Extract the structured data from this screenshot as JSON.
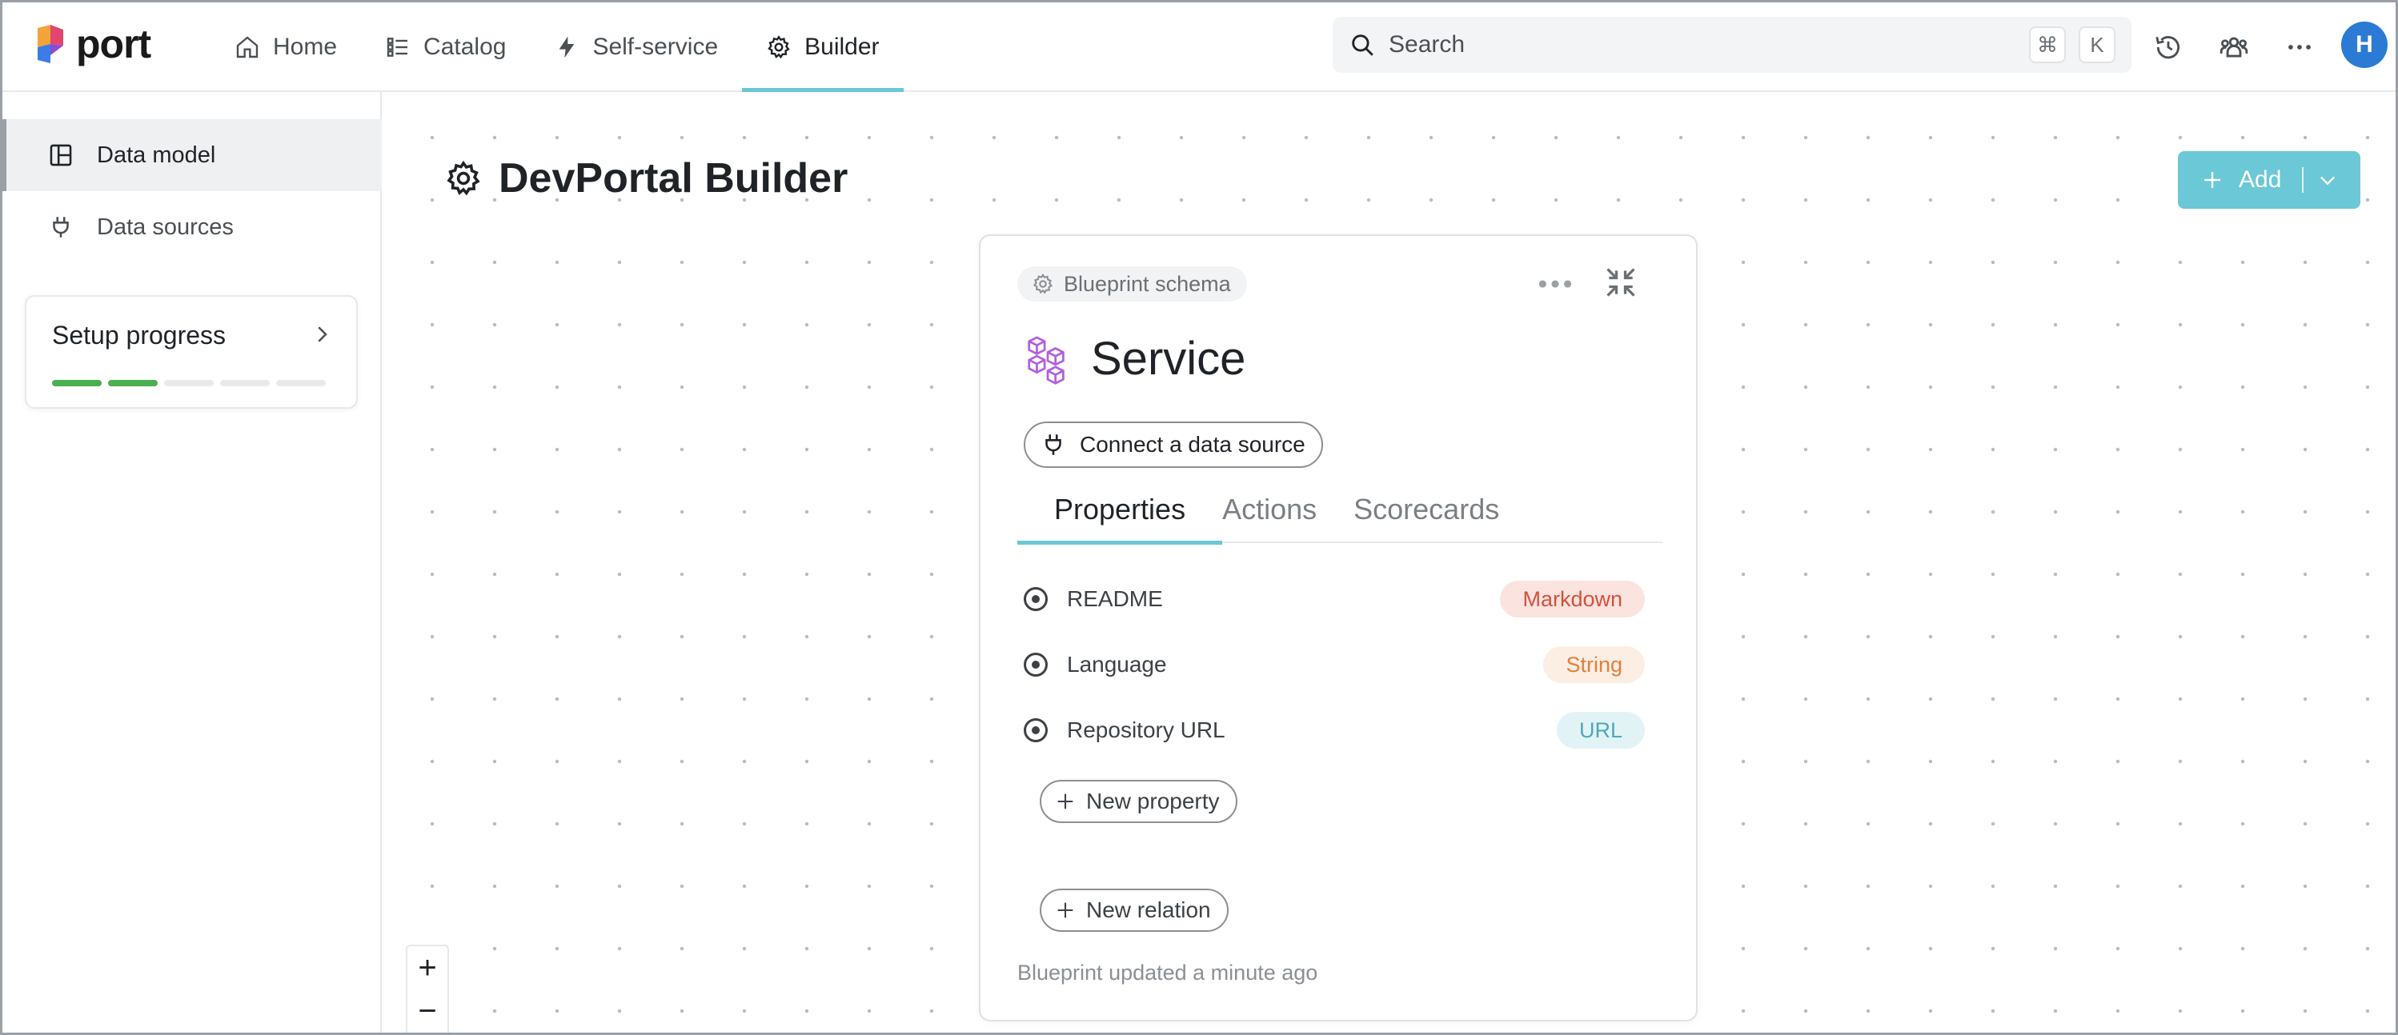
{
  "brand": {
    "name": "port",
    "accent": "#6bc8d6"
  },
  "nav": {
    "items": [
      {
        "label": "Home",
        "icon": "home-icon"
      },
      {
        "label": "Catalog",
        "icon": "list-icon"
      },
      {
        "label": "Self-service",
        "icon": "lightning-icon"
      },
      {
        "label": "Builder",
        "icon": "gear-icon",
        "active": true
      }
    ]
  },
  "search": {
    "placeholder": "Search",
    "shortcut_mod": "⌘",
    "shortcut_key": "K"
  },
  "user": {
    "initial": "H"
  },
  "sidebar": {
    "items": [
      {
        "label": "Data model",
        "icon": "layout-icon",
        "active": true
      },
      {
        "label": "Data sources",
        "icon": "plug-icon"
      }
    ],
    "setup": {
      "title": "Setup progress",
      "steps_total": 5,
      "steps_done": 2
    }
  },
  "page": {
    "title": "DevPortal Builder"
  },
  "add_button": {
    "label": "Add"
  },
  "zoom": {
    "in": "+",
    "out": "−"
  },
  "blueprint": {
    "chip": "Blueprint schema",
    "title": "Service",
    "connect_label": "Connect a data source",
    "tabs": [
      {
        "label": "Properties",
        "active": true
      },
      {
        "label": "Actions"
      },
      {
        "label": "Scorecards"
      }
    ],
    "properties": [
      {
        "name": "README",
        "type": "Markdown",
        "kind": "markdown"
      },
      {
        "name": "Language",
        "type": "String",
        "kind": "string"
      },
      {
        "name": "Repository URL",
        "type": "URL",
        "kind": "url"
      }
    ],
    "new_property": "New property",
    "new_relation": "New relation",
    "updated": "Blueprint updated a minute ago"
  }
}
